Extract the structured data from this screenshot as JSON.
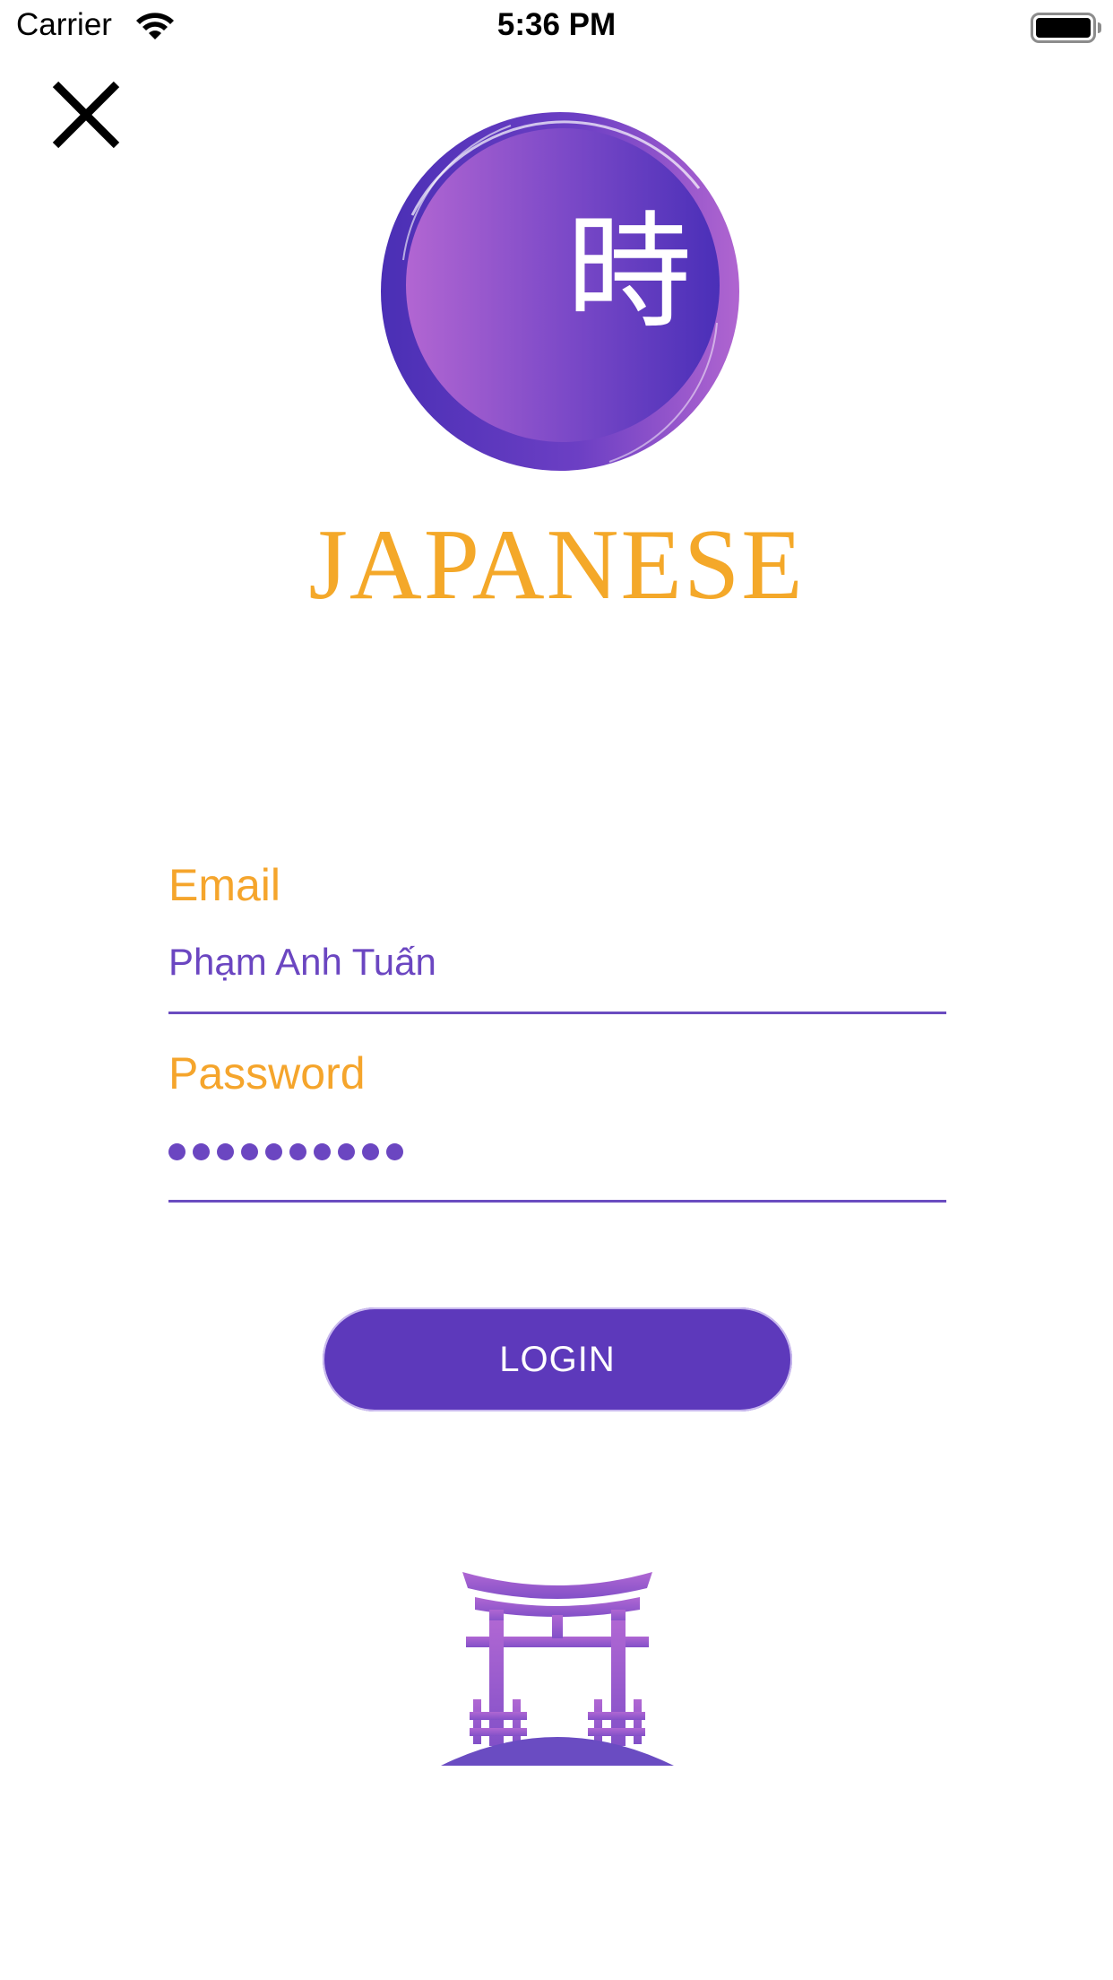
{
  "status_bar": {
    "carrier": "Carrier",
    "time": "5:36 PM",
    "wifi_icon": "wifi-icon",
    "battery_icon": "battery-full-icon"
  },
  "close_button": {
    "icon": "close-icon"
  },
  "logo": {
    "glyph": "時",
    "brand": "JAPANESE"
  },
  "form": {
    "email": {
      "label": "Email",
      "value": "Phạm Anh Tuấn"
    },
    "password": {
      "label": "Password",
      "masked_length": 10
    }
  },
  "login_button": {
    "label": "LOGIN"
  },
  "colors": {
    "accent_orange": "#f4a829",
    "accent_purple": "#5d39bb",
    "text_purple": "#6b46c1",
    "gradient_light": "#b065d0",
    "gradient_dark": "#4a2fb5"
  },
  "decoration": {
    "icon": "torii-gate-icon"
  }
}
